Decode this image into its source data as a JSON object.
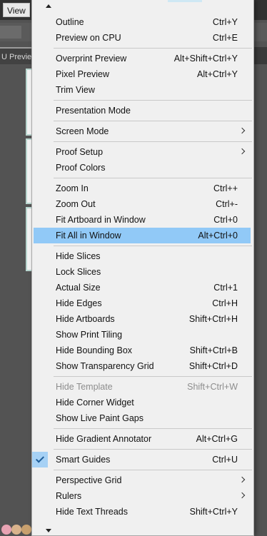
{
  "menubar": {
    "view_label": "View"
  },
  "document_tab": {
    "label": "U Preview"
  },
  "menu": {
    "groups": [
      [
        {
          "label": "Outline",
          "shortcut": "Ctrl+Y"
        },
        {
          "label": "Preview on CPU",
          "shortcut": "Ctrl+E"
        }
      ],
      [
        {
          "label": "Overprint Preview",
          "shortcut": "Alt+Shift+Ctrl+Y"
        },
        {
          "label": "Pixel Preview",
          "shortcut": "Alt+Ctrl+Y"
        },
        {
          "label": "Trim View",
          "shortcut": ""
        }
      ],
      [
        {
          "label": "Presentation Mode",
          "shortcut": ""
        }
      ],
      [
        {
          "label": "Screen Mode",
          "shortcut": "",
          "submenu": true
        }
      ],
      [
        {
          "label": "Proof Setup",
          "shortcut": "",
          "submenu": true
        },
        {
          "label": "Proof Colors",
          "shortcut": ""
        }
      ],
      [
        {
          "label": "Zoom In",
          "shortcut": "Ctrl++"
        },
        {
          "label": "Zoom Out",
          "shortcut": "Ctrl+-"
        },
        {
          "label": "Fit Artboard in Window",
          "shortcut": "Ctrl+0"
        },
        {
          "label": "Fit All in Window",
          "shortcut": "Alt+Ctrl+0",
          "highlighted": true
        }
      ],
      [
        {
          "label": "Hide Slices",
          "shortcut": ""
        },
        {
          "label": "Lock Slices",
          "shortcut": ""
        },
        {
          "label": "Actual Size",
          "shortcut": "Ctrl+1"
        },
        {
          "label": "Hide Edges",
          "shortcut": "Ctrl+H"
        },
        {
          "label": "Hide Artboards",
          "shortcut": "Shift+Ctrl+H"
        },
        {
          "label": "Show Print Tiling",
          "shortcut": ""
        },
        {
          "label": "Hide Bounding Box",
          "shortcut": "Shift+Ctrl+B"
        },
        {
          "label": "Show Transparency Grid",
          "shortcut": "Shift+Ctrl+D"
        }
      ],
      [
        {
          "label": "Hide Template",
          "shortcut": "Shift+Ctrl+W",
          "disabled": true
        },
        {
          "label": "Hide Corner Widget",
          "shortcut": ""
        },
        {
          "label": "Show Live Paint Gaps",
          "shortcut": ""
        }
      ],
      [
        {
          "label": "Hide Gradient Annotator",
          "shortcut": "Alt+Ctrl+G"
        }
      ],
      [
        {
          "label": "Smart Guides",
          "shortcut": "Ctrl+U",
          "checked": true
        }
      ],
      [
        {
          "label": "Perspective Grid",
          "shortcut": "",
          "submenu": true
        },
        {
          "label": "Rulers",
          "shortcut": "",
          "submenu": true
        },
        {
          "label": "Hide Text Threads",
          "shortcut": "Shift+Ctrl+Y"
        }
      ]
    ]
  },
  "colors": {
    "menu_bg": "#f0f0f0",
    "highlight": "#91c9f7",
    "check_bg": "#a6d1f5",
    "disabled_text": "#8d8d8d",
    "app_bg": "#535353"
  },
  "icons": [
    "scroll-up-arrow-icon",
    "scroll-down-arrow-icon",
    "submenu-chevron-icon",
    "checkmark-icon"
  ]
}
